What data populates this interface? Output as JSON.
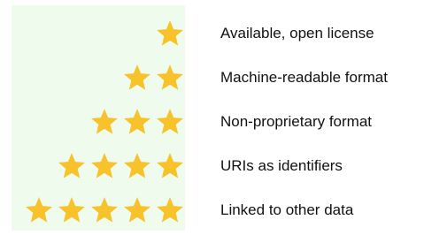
{
  "star_color": "#f7c22a",
  "panel_color": "#eefbed",
  "levels": [
    {
      "stars": 1,
      "label": "Available, open license"
    },
    {
      "stars": 2,
      "label": "Machine-readable format"
    },
    {
      "stars": 3,
      "label": "Non-proprietary format"
    },
    {
      "stars": 4,
      "label": "URIs as identifiers"
    },
    {
      "stars": 5,
      "label": "Linked to other data"
    }
  ]
}
